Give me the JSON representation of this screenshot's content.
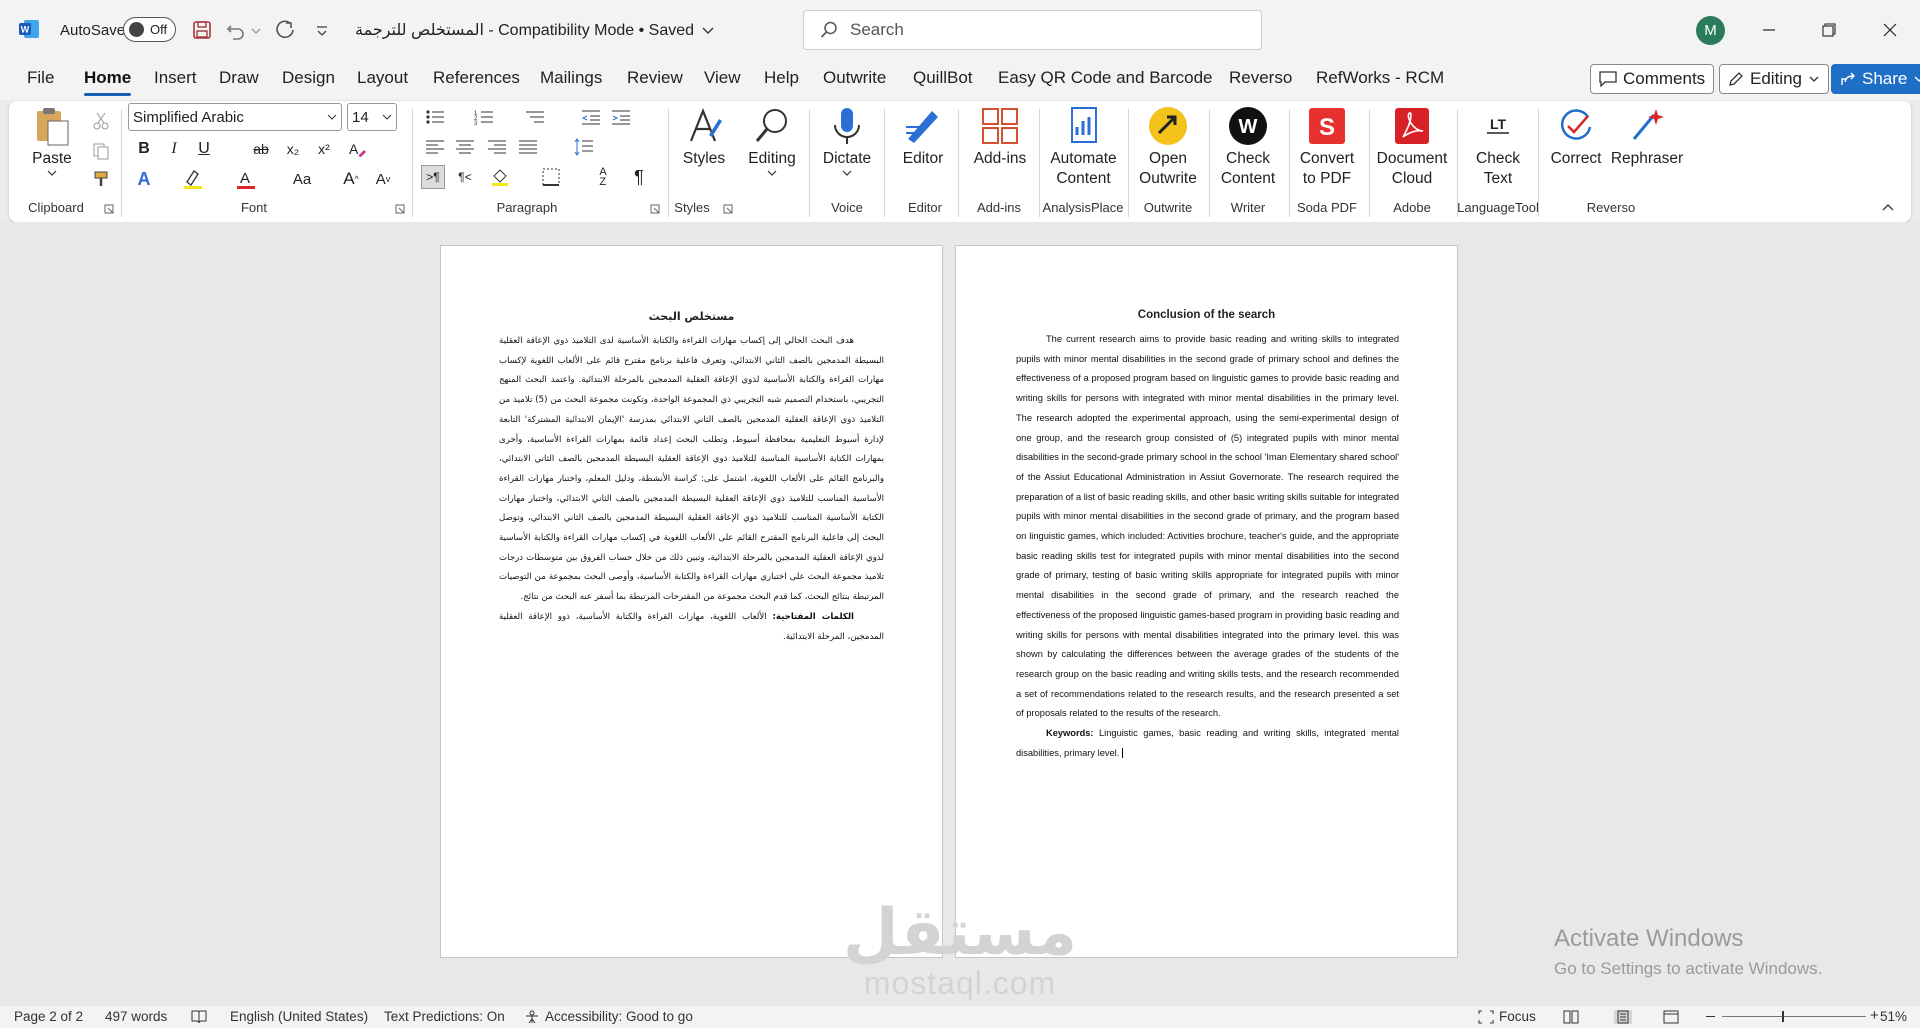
{
  "titlebar": {
    "autosave_label": "AutoSave",
    "autosave_state": "Off",
    "document_title": "المستخلص للترجمة  -  Compatibility Mode • Saved",
    "search_placeholder": "Search",
    "user_initial": "M"
  },
  "tabs": [
    "File",
    "Home",
    "Insert",
    "Draw",
    "Design",
    "Layout",
    "References",
    "Mailings",
    "Review",
    "View",
    "Help",
    "Outwrite",
    "QuillBot",
    "Easy QR Code and Barcode",
    "Reverso",
    "RefWorks - RCM"
  ],
  "active_tab": "Home",
  "header_buttons": {
    "comments": "Comments",
    "editing": "Editing",
    "share": "Share"
  },
  "ribbon": {
    "clipboard": {
      "paste": "Paste",
      "label": "Clipboard"
    },
    "font": {
      "name": "Simplified Arabic",
      "size": "14",
      "label": "Font",
      "case_label": "Aa"
    },
    "paragraph": {
      "label": "Paragraph"
    },
    "styles": {
      "button": "Styles",
      "label": "Styles"
    },
    "editing": {
      "button": "Editing"
    },
    "voice": {
      "button": "Dictate",
      "label": "Voice"
    },
    "editor": {
      "button": "Editor",
      "label": "Editor"
    },
    "addins": {
      "button": "Add-ins",
      "label": "Add-ins"
    },
    "analysisplace": {
      "button_line1": "Automate",
      "button_line2": "Content",
      "label": "AnalysisPlace"
    },
    "outwrite": {
      "button_line1": "Open",
      "button_line2": "Outwrite",
      "label": "Outwrite"
    },
    "writer": {
      "button_line1": "Check",
      "button_line2": "Content",
      "label": "Writer"
    },
    "sodapdf": {
      "button_line1": "Convert",
      "button_line2": "to PDF",
      "label": "Soda PDF"
    },
    "adobe": {
      "button_line1": "Document",
      "button_line2": "Cloud",
      "label": "Adobe"
    },
    "languagetool": {
      "button_line1": "Check",
      "button_line2": "Text",
      "label": "LanguageTool"
    },
    "reverso": {
      "correct": "Correct",
      "rephraser": "Rephraser",
      "label": "Reverso"
    }
  },
  "page1": {
    "title": "مستخلص البحث",
    "body": "هدف البحث الحالي إلى إكساب مهارات القراءة والكتابة الأساسية لدى التلاميذ ذوي الإعاقة العقلية البسيطة المدمجين بالصف الثاني الابتدائي، وتعرف فاعلية برنامج مقترح قائم على الألعاب اللغوية لإكساب مهارات القراءة والكتابة الأساسية لذوي الإعاقة العقلية المدمجين بالمرحلة الابتدائية. واعتمد البحث المنهج التجريبي، باستخدام التصميم شبه التجريبي ذي المجموعة الواحدة، وتكونت مجموعة البحث من (5) تلاميذ من التلاميذ ذوي الإعاقة العقلية المدمجين بالصف الثاني الابتدائي بمدرسة 'الإيمان الابتدائية المشتركة' التابعة لإدارة أسيوط التعليمية بمحافظة أسيوط، وتطلب البحث إعداد قائمة بمهارات القراءة الأساسية، وأخرى بمهارات الكتابة الأساسية المناسبة للتلاميذ ذوي الإعاقة العقلية البسيطة المدمجين بالصف الثاني الابتدائي، والبرنامج القائم على الألعاب اللغوية، اشتمل على: كراسة الأنشطة، ودليل المعلم، واختبار مهارات القراءة الأساسية المناسب للتلاميذ ذوي الإعاقة العقلية البسيطة المدمجين بالصف الثاني الابتدائي، واختبار مهارات الكتابة الأساسية المناسب للتلاميذ ذوي الإعاقة العقلية البسيطة المدمجين بالصف الثاني الابتدائي، وتوصل البحث إلى فاعلية البرنامج المقترح القائم على الألعاب اللغوية في إكساب مهارات القراءة والكتابة الأساسية لذوي الإعاقة العقلية المدمجين بالمرحلة الابتدائية، وتبين ذلك من خلال حساب الفروق بين متوسطات درجات تلاميذ مجموعة البحث على اختباري مهارات القراءة والكتابة الأساسية، وأوصى البحث بمجموعة من التوصيات المرتبطة بنتائج البحث، كما قدم البحث مجموعة من المقترحات المرتبطة بما أسفر عنه البحث من نتائج.",
    "keywords_label": "الكلمات المفتاحية:",
    "keywords": " الألعاب اللغوية، مهارات القراءة والكتابة الأساسية، ذوو الإعاقة العقلية المدمجين، المرحلة الابتدائية."
  },
  "page2": {
    "title": "Conclusion of the search",
    "body": "The current research aims to provide basic reading and writing skills to integrated pupils with minor mental disabilities in the second grade of primary school and defines the effectiveness of a proposed program based on linguistic games to provide basic reading and writing skills for persons with integrated with minor mental disabilities in the primary level. The research adopted the experimental approach, using the semi-experimental design of one group, and the research group consisted of (5) integrated pupils with minor mental disabilities in the second-grade primary school in the school 'Iman Elementary shared school' of the Assiut Educational Administration in Assiut Governorate.  The research required the preparation of a list of basic reading skills, and other basic writing skills suitable for integrated pupils with minor mental disabilities in the second grade of primary, and the program based on linguistic  games, which included: Activities brochure, teacher's guide, and the appropriate basic reading skills test for integrated pupils with minor mental disabilities into the second grade of primary, testing of basic writing skills appropriate for integrated pupils with minor mental disabilities in the second grade of primary, and the research reached the effectiveness of the proposed linguistic  games-based program in providing basic reading and writing skills for persons with mental disabilities integrated into the primary level. this was shown by calculating the differences between the average grades of the students of the research group on the basic reading and writing skills tests, and the research recommended a set of recommendations related to the research results, and the research presented a set of proposals related to the results of the research.",
    "keywords_label": "Keywords:",
    "keywords": " Linguistic games, basic reading and writing skills, integrated mental disabilities, primary level."
  },
  "watermark": {
    "arabic": "مستقل",
    "latin": "mostaql.com"
  },
  "activate": {
    "line1": "Activate Windows",
    "line2": "Go to Settings to activate Windows."
  },
  "status": {
    "page": "Page 2 of 2",
    "words": "497 words",
    "language": "English (United States)",
    "predictions": "Text Predictions: On",
    "accessibility": "Accessibility: Good to go",
    "focus": "Focus",
    "zoom": "51%"
  }
}
